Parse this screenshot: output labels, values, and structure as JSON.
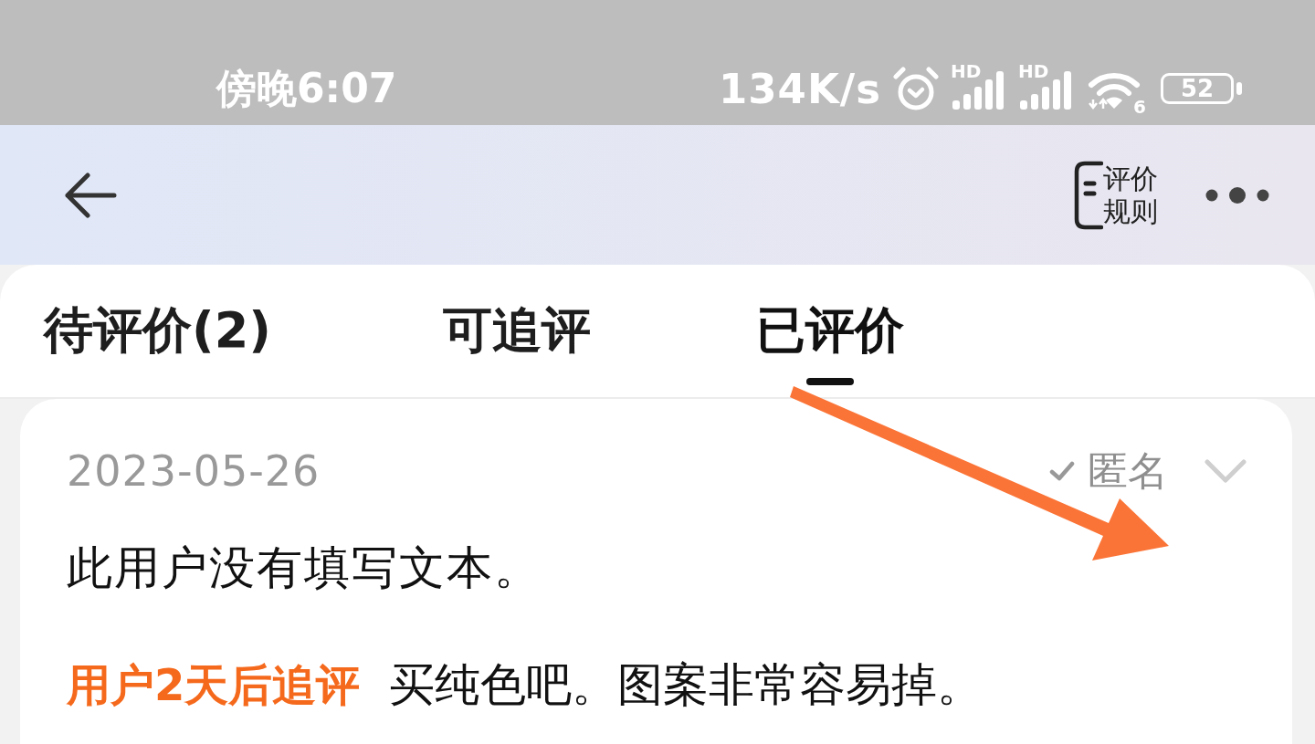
{
  "status_bar": {
    "time": "傍晚6:07",
    "network_speed": "134K/s",
    "signals": [
      {
        "badge": "HD"
      },
      {
        "badge": "HD"
      }
    ],
    "wifi_badge": "6",
    "battery": "52"
  },
  "header": {
    "rules_button": "评价规则"
  },
  "tabs": [
    {
      "label": "待评价(2)",
      "selected": false
    },
    {
      "label": "可追评",
      "selected": false
    },
    {
      "label": "已评价",
      "selected": true
    }
  ],
  "reviews": [
    {
      "date": "2023-05-26",
      "anonymous": {
        "label": "匿名",
        "checked": true
      },
      "expanded": false,
      "text": "此用户没有填写文本。",
      "follow_up": {
        "tag": "用户2天后追评",
        "text": "买纯色吧。图案非常容易掉。"
      }
    }
  ]
}
